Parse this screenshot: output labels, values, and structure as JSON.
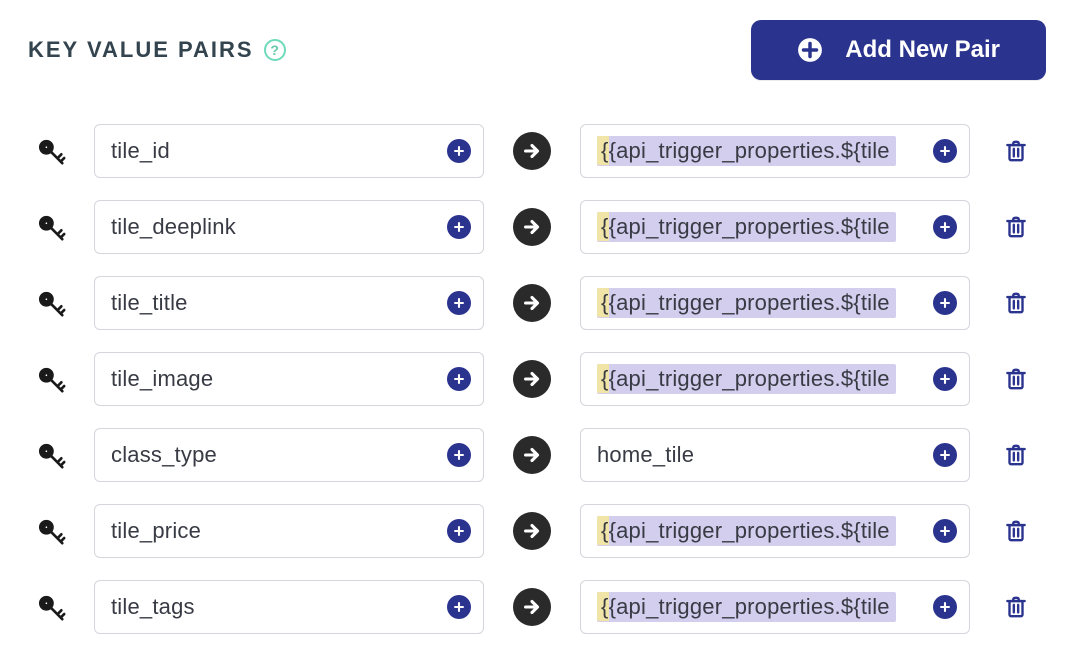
{
  "header": {
    "title": "KEY VALUE PAIRS",
    "help_symbol": "?",
    "add_label": "Add New Pair"
  },
  "colors": {
    "primary": "#2a338e",
    "variable_bg": "#d3cdee"
  },
  "pairs": [
    {
      "key": "tile_id",
      "value_display": "{{api_trigger_properties.${tile",
      "is_variable": true
    },
    {
      "key": "tile_deeplink",
      "value_display": "{{api_trigger_properties.${tile",
      "is_variable": true
    },
    {
      "key": "tile_title",
      "value_display": "{{api_trigger_properties.${tile",
      "is_variable": true
    },
    {
      "key": "tile_image",
      "value_display": "{{api_trigger_properties.${tile",
      "is_variable": true
    },
    {
      "key": "class_type",
      "value_display": "home_tile",
      "is_variable": false
    },
    {
      "key": "tile_price",
      "value_display": "{{api_trigger_properties.${tile",
      "is_variable": true
    },
    {
      "key": "tile_tags",
      "value_display": "{{api_trigger_properties.${tile",
      "is_variable": true
    }
  ]
}
